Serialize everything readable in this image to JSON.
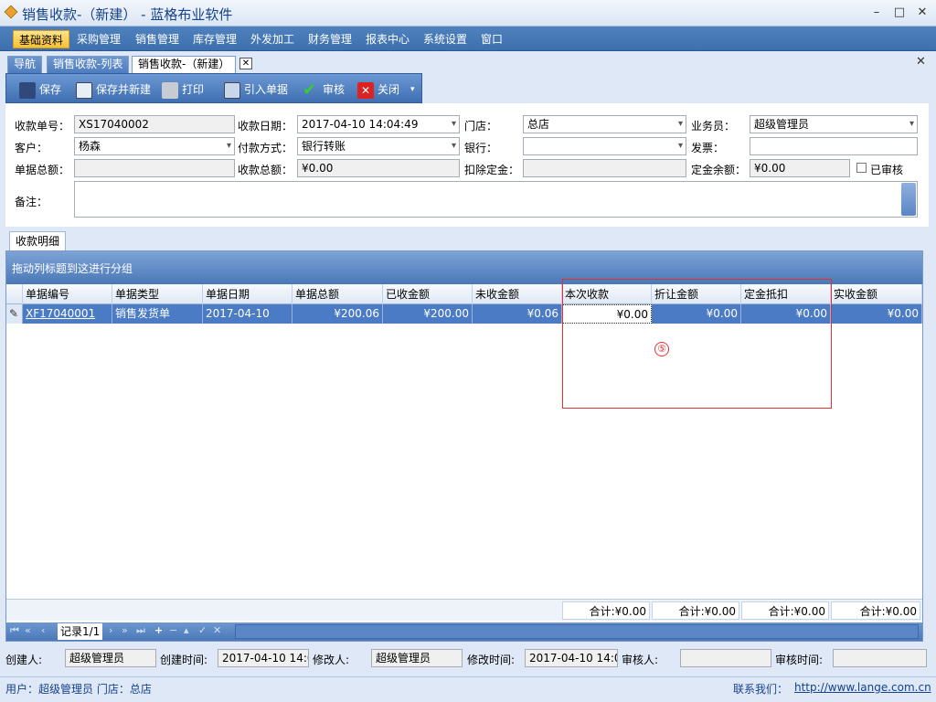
{
  "window": {
    "title": "销售收款-（新建） - 蓝格布业软件",
    "min": "–",
    "max": "□",
    "close": "✕"
  },
  "menu": [
    "基础资料",
    "采购管理",
    "销售管理",
    "库存管理",
    "外发加工",
    "财务管理",
    "报表中心",
    "系统设置",
    "窗口"
  ],
  "tabs": [
    "导航",
    "销售收款-列表",
    "销售收款-（新建）"
  ],
  "tab_close": "✕",
  "panel_close": "✕",
  "toolbar": {
    "save": "保存",
    "save_new": "保存并新建",
    "print": "打印",
    "import": "引入单据",
    "audit": "审核",
    "close": "关闭"
  },
  "form": {
    "receipt_no_label": "收款单号：",
    "receipt_no": "XS17040002",
    "date_label": "收款日期：",
    "date": "2017-04-10 14:04:49",
    "store_label": "门店：",
    "store": "总店",
    "salesman_label": "业务员：",
    "salesman": "超级管理员",
    "customer_label": "客户：",
    "customer": "杨森",
    "pay_label": "付款方式：",
    "pay": "银行转账",
    "bank_label": "银行：",
    "bank": "",
    "invoice_label": "发票：",
    "invoice": "",
    "bill_total_label": "单据总额：",
    "bill_total": "",
    "recv_total_label": "收款总额：",
    "recv_total": "¥0.00",
    "deposit_deduct_label": "扣除定金：",
    "deposit_deduct": "",
    "deposit_balance_label": "定金余额：",
    "deposit_balance": "¥0.00",
    "audited_label": "已审核",
    "remark_label": "备注：",
    "remark": ""
  },
  "detail_tab": "收款明细",
  "grid": {
    "group_hint": "拖动列标题到这进行分组",
    "columns": [
      "单据编号",
      "单据类型",
      "单据日期",
      "单据总额",
      "已收金额",
      "未收金额",
      "本次收款",
      "折让金额",
      "定金抵扣",
      "实收金额"
    ],
    "rows": [
      [
        "XF17040001",
        "销售发货单",
        "2017-04-10",
        "¥200.06",
        "¥200.00",
        "¥0.06",
        "¥0.00",
        "¥0.00",
        "¥0.00",
        "¥0.00"
      ]
    ],
    "footer": [
      "合计:¥0.00",
      "合计:¥0.00",
      "合计:¥0.00",
      "合计:¥0.00"
    ],
    "records": "记录1/1"
  },
  "annotation": "⑤",
  "audit": {
    "creator_label": "创建人:",
    "creator": "超级管理员",
    "create_time_label": "创建时间:",
    "create_time": "2017-04-10 14:0",
    "modifier_label": "修改人:",
    "modifier": "超级管理员",
    "modify_time_label": "修改时间:",
    "modify_time": "2017-04-10 14:0",
    "auditor_label": "审核人:",
    "auditor": "",
    "audit_time_label": "审核时间:",
    "audit_time": ""
  },
  "status": {
    "user": "用户：超级管理员  门店：总店",
    "contact_label": "联系我们：",
    "url": "http://www.lange.com.cn"
  }
}
